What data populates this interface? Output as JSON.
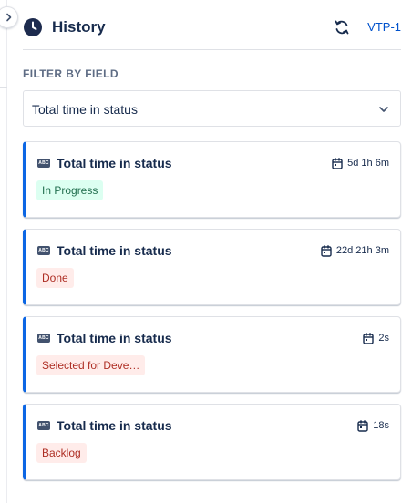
{
  "header": {
    "title": "History",
    "issue_key": "VTP-1",
    "icons": {
      "history": "clock-icon",
      "refresh": "refresh-icon",
      "collapse": "chevron-right-icon"
    }
  },
  "filter": {
    "label": "FILTER BY FIELD",
    "selected": "Total time in status"
  },
  "entries": [
    {
      "field": "Total time in status",
      "duration": "5d 1h 6m",
      "status": "In Progress",
      "status_color": "green"
    },
    {
      "field": "Total time in status",
      "duration": "22d 21h 3m",
      "status": "Done",
      "status_color": "red"
    },
    {
      "field": "Total time in status",
      "duration": "2s",
      "status": "Selected for Deve…",
      "status_color": "red"
    },
    {
      "field": "Total time in status",
      "duration": "18s",
      "status": "Backlog",
      "status_color": "red"
    }
  ],
  "colors": {
    "accent": "#0c66e4",
    "link": "#0052cc",
    "success_bg": "#dcfff1",
    "success_text": "#216e4e",
    "danger_bg": "#ffecea",
    "danger_text": "#ae2e24"
  }
}
